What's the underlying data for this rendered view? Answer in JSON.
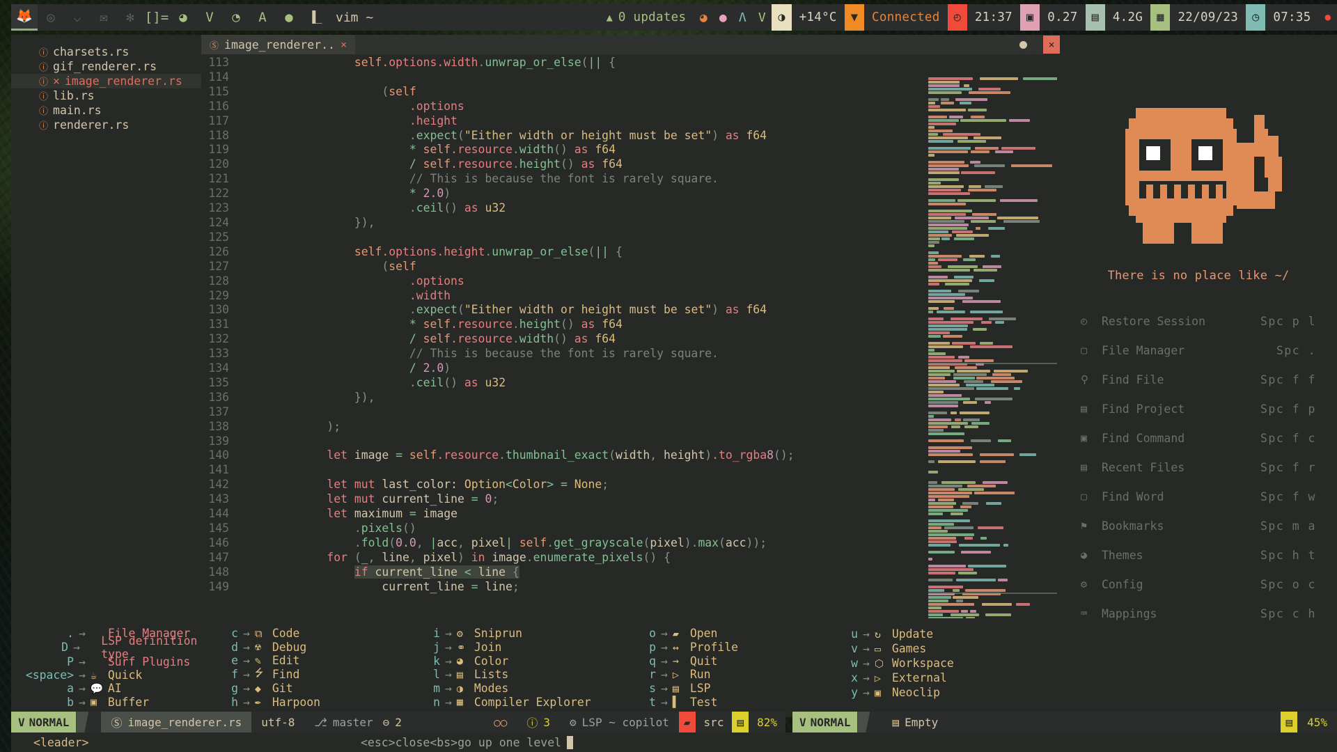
{
  "topbar": {
    "launchers": [
      {
        "name": "firefox-icon",
        "glyph": "🦊",
        "color": "#7fbbb3",
        "active": true
      },
      {
        "name": "chrome-icon",
        "glyph": "◎",
        "color": "#5b605a"
      },
      {
        "name": "download-icon",
        "glyph": "⌵",
        "color": "#5b605a"
      },
      {
        "name": "mail-icon",
        "glyph": "✉",
        "color": "#5b605a"
      },
      {
        "name": "settings-gear-icon",
        "glyph": "✻",
        "color": "#5b605a"
      },
      {
        "name": "terminal-prompt-icon",
        "glyph": "[]=",
        "color": "#a7c080"
      },
      {
        "name": "thunderbird-icon",
        "glyph": "◕",
        "color": "#a7c080"
      },
      {
        "name": "vim-icon",
        "glyph": "V",
        "color": "#a7c080"
      },
      {
        "name": "firefox-dev-icon",
        "glyph": "◔",
        "color": "#a7c080"
      },
      {
        "name": "arch-icon",
        "glyph": "A",
        "color": "#a7c080"
      },
      {
        "name": "dot-icon",
        "glyph": "●",
        "color": "#a7c080"
      }
    ],
    "workspace_icon": "▐_",
    "workspace_label": "vim ~",
    "updates": {
      "icon": "▲",
      "label": "0 updates"
    },
    "tray": [
      {
        "name": "firefox-tray-icon",
        "glyph": "◕",
        "color": "#e8833a"
      },
      {
        "name": "thunderbird-tray-icon",
        "glyph": "●",
        "color": "#e8a0c0"
      },
      {
        "name": "archupdate-tray-icon",
        "glyph": "Λ",
        "color": "#7fbbb3"
      },
      {
        "name": "neovim-tray-icon",
        "glyph": "V",
        "color": "#a7c080"
      }
    ],
    "brightness": {
      "icon": "◑",
      "bg": "#e8e0c0"
    },
    "temperature": "+14°C",
    "wifi": {
      "icon": "▼",
      "bg": "#f08a24",
      "label": "Connected"
    },
    "clock": {
      "icon": "◴",
      "bg": "#f04a3a",
      "label": "21:37"
    },
    "cpu": {
      "icon": "▣",
      "bg": "#e0a0b4",
      "label": "0.27"
    },
    "ram": {
      "icon": "▤",
      "bg": "#a7c0b0",
      "label": "4.2G"
    },
    "date": {
      "icon": "▦",
      "bg": "#a7c080",
      "label": "22/09/23"
    },
    "uptime": {
      "icon": "◷",
      "bg": "#7fbbb3",
      "label": "07:35"
    },
    "power": {
      "icon": "●",
      "color": "#f04a3a"
    }
  },
  "filetree": {
    "items": [
      {
        "icon": "rust-icon",
        "name": "charsets.rs",
        "modified": false,
        "selected": false
      },
      {
        "icon": "rust-icon",
        "name": "gif_renderer.rs",
        "modified": false,
        "selected": false
      },
      {
        "icon": "rust-icon",
        "name": "image_renderer.rs",
        "modified": true,
        "modified_mark": "×",
        "selected": true
      },
      {
        "icon": "rust-icon",
        "name": "lib.rs",
        "modified": false,
        "selected": false
      },
      {
        "icon": "rust-icon",
        "name": "main.rs",
        "modified": false,
        "selected": false
      },
      {
        "icon": "rust-icon",
        "name": "renderer.rs",
        "modified": false,
        "selected": false
      }
    ]
  },
  "editor": {
    "tab": {
      "icon": "rust-icon",
      "label": "image_renderer..",
      "close": "×"
    },
    "window_buttons": {
      "minimize": "",
      "close": "×"
    },
    "first_line": 113,
    "lines": [
      {
        "n": 113,
        "t": "                self.options.width.unwrap_or_else(|| {"
      },
      {
        "n": 114,
        "t": ""
      },
      {
        "n": 115,
        "t": "                    (self"
      },
      {
        "n": 116,
        "t": "                        .options"
      },
      {
        "n": 117,
        "t": "                        .height"
      },
      {
        "n": 118,
        "t": "                        .expect(\"Either width or height must be set\") as f64"
      },
      {
        "n": 119,
        "t": "                        * self.resource.width() as f64"
      },
      {
        "n": 120,
        "t": "                        / self.resource.height() as f64"
      },
      {
        "n": 121,
        "t": "                        // This is because the font is rarely square."
      },
      {
        "n": 122,
        "t": "                        * 2.0)"
      },
      {
        "n": 123,
        "t": "                        .ceil() as u32"
      },
      {
        "n": 124,
        "t": "                }),"
      },
      {
        "n": 125,
        "t": ""
      },
      {
        "n": 126,
        "t": "                self.options.height.unwrap_or_else(|| {"
      },
      {
        "n": 127,
        "t": "                    (self"
      },
      {
        "n": 128,
        "t": "                        .options"
      },
      {
        "n": 129,
        "t": "                        .width"
      },
      {
        "n": 130,
        "t": "                        .expect(\"Either width or height must be set\") as f64"
      },
      {
        "n": 131,
        "t": "                        * self.resource.height() as f64"
      },
      {
        "n": 132,
        "t": "                        / self.resource.width() as f64"
      },
      {
        "n": 133,
        "t": "                        // This is because the font is rarely square."
      },
      {
        "n": 134,
        "t": "                        / 2.0)"
      },
      {
        "n": 135,
        "t": "                        .ceil() as u32"
      },
      {
        "n": 136,
        "t": "                }),"
      },
      {
        "n": 137,
        "t": ""
      },
      {
        "n": 138,
        "t": "            );"
      },
      {
        "n": 139,
        "t": ""
      },
      {
        "n": 140,
        "t": "            let image = self.resource.thumbnail_exact(width, height).to_rgba8();"
      },
      {
        "n": 141,
        "t": ""
      },
      {
        "n": 142,
        "t": "            let mut last_color: Option<Color> = None;"
      },
      {
        "n": 143,
        "t": "            let mut current_line = 0;"
      },
      {
        "n": 144,
        "t": "            let maximum = image"
      },
      {
        "n": 145,
        "t": "                .pixels()"
      },
      {
        "n": 146,
        "t": "                .fold(0.0, |acc, pixel| self.get_grayscale(pixel).max(acc));"
      },
      {
        "n": 147,
        "t": "            for (_, line, pixel) in image.enumerate_pixels() {"
      },
      {
        "n": 148,
        "t": "                if current_line < line {"
      },
      {
        "n": 149,
        "t": "                    current_line = line;"
      }
    ]
  },
  "whichkey": {
    "columns": [
      {
        "rows": [
          {
            "key": ".",
            "label": "File Manager",
            "icon": "",
            "style": "red"
          },
          {
            "key": "D",
            "label": "LSP definition type",
            "icon": "",
            "style": "red"
          },
          {
            "key": "P",
            "label": "Surf Plugins",
            "icon": "",
            "style": "red"
          },
          {
            "key": "<space>",
            "label": "Quick",
            "icon": "☕",
            "style": "yellow"
          },
          {
            "key": "a",
            "label": "AI",
            "icon": "💬",
            "style": "yellow"
          },
          {
            "key": "b",
            "label": "Buffer",
            "icon": "▣",
            "style": "yellow"
          }
        ]
      },
      {
        "rows": [
          {
            "key": "c",
            "label": "Code",
            "icon": "⧉",
            "style": "yellow"
          },
          {
            "key": "d",
            "label": "Debug",
            "icon": "☢",
            "style": "yellow"
          },
          {
            "key": "e",
            "label": "Edit",
            "icon": "✎",
            "style": "yellow"
          },
          {
            "key": "f",
            "label": "Find",
            "icon": "⭍",
            "style": "yellow"
          },
          {
            "key": "g",
            "label": "Git",
            "icon": "◆",
            "style": "yellow"
          },
          {
            "key": "h",
            "label": "Harpoon",
            "icon": "✒",
            "style": "yellow"
          }
        ]
      },
      {
        "rows": [
          {
            "key": "i",
            "label": "Sniprun",
            "icon": "⚙",
            "style": "yellow"
          },
          {
            "key": "j",
            "label": "Join",
            "icon": "⚭",
            "style": "yellow"
          },
          {
            "key": "k",
            "label": "Color",
            "icon": "◕",
            "style": "yellow"
          },
          {
            "key": "l",
            "label": "Lists",
            "icon": "▤",
            "style": "yellow"
          },
          {
            "key": "m",
            "label": "Modes",
            "icon": "◑",
            "style": "yellow"
          },
          {
            "key": "n",
            "label": "Compiler Explorer",
            "icon": "▦",
            "style": "yellow"
          }
        ]
      },
      {
        "rows": [
          {
            "key": "o",
            "label": "Open",
            "icon": "▰",
            "style": "yellow"
          },
          {
            "key": "p",
            "label": "Profile",
            "icon": "↔",
            "style": "yellow"
          },
          {
            "key": "q",
            "label": "Quit",
            "icon": "→",
            "style": "yellow"
          },
          {
            "key": "r",
            "label": "Run",
            "icon": "▷",
            "style": "yellow"
          },
          {
            "key": "s",
            "label": "LSP",
            "icon": "▤",
            "style": "yellow"
          },
          {
            "key": "t",
            "label": "Test",
            "icon": "▌",
            "style": "yellow"
          }
        ]
      },
      {
        "rows": [
          {
            "key": "u",
            "label": "Update",
            "icon": "↻",
            "style": "yellow"
          },
          {
            "key": "v",
            "label": "Games",
            "icon": "▭",
            "style": "yellow"
          },
          {
            "key": "w",
            "label": "Workspace",
            "icon": "⬡",
            "style": "yellow"
          },
          {
            "key": "x",
            "label": "External",
            "icon": "▷",
            "style": "yellow"
          },
          {
            "key": "y",
            "label": "Neoclip",
            "icon": "▣",
            "style": "yellow"
          }
        ]
      }
    ]
  },
  "dashboard": {
    "quote": "There is no place like ~/",
    "items": [
      {
        "icon": "restore-icon",
        "glyph": "◴",
        "label": "Restore Session",
        "key": "Spc p l"
      },
      {
        "icon": "folder-icon",
        "glyph": "▢",
        "label": "File Manager",
        "key": "Spc ."
      },
      {
        "icon": "search-icon",
        "glyph": "⚲",
        "label": "Find File",
        "key": "Spc f f"
      },
      {
        "icon": "project-icon",
        "glyph": "▤",
        "label": "Find Project",
        "key": "Spc f p"
      },
      {
        "icon": "command-icon",
        "glyph": "▣",
        "label": "Find Command",
        "key": "Spc f c"
      },
      {
        "icon": "recent-files-icon",
        "glyph": "▤",
        "label": "Recent Files",
        "key": "Spc f r"
      },
      {
        "icon": "word-icon",
        "glyph": "▢",
        "label": "Find Word",
        "key": "Spc f w"
      },
      {
        "icon": "bookmark-icon",
        "glyph": "⚑",
        "label": "Bookmarks",
        "key": "Spc m a"
      },
      {
        "icon": "palette-icon",
        "glyph": "◕",
        "label": "Themes",
        "key": "Spc h t"
      },
      {
        "icon": "gear-icon",
        "glyph": "⚙",
        "label": "Config",
        "key": "Spc o c"
      },
      {
        "icon": "keyboard-icon",
        "glyph": "⌨",
        "label": "Mappings",
        "key": "Spc c h"
      }
    ]
  },
  "statusbar": {
    "left": {
      "mode_icon": "V",
      "mode": "NORMAL",
      "file_icon": "rust-icon",
      "file": "image_renderer.rs",
      "encoding": "utf-8",
      "branch_icon": "⎇",
      "branch": "master",
      "diff_icon": "⊖",
      "diff_count": "2"
    },
    "center": {
      "copilot_icon": "○○",
      "info_icon": "ⓘ",
      "info_count": "3",
      "lsp_icon": "⚙",
      "lsp": "LSP ~ copilot",
      "folder_icon": "▰",
      "folder": "src",
      "progress_icon": "▤",
      "progress": "82%"
    },
    "right": {
      "mode_icon": "V",
      "mode": "NORMAL",
      "buffer_icon": "▤",
      "buffer": "Empty",
      "progress_icon": "▤",
      "progress": "45%"
    }
  },
  "cmdline": {
    "leader": "<leader>",
    "hint_esc": "<esc>",
    "hint_close": " close ",
    "hint_bs": "<bs>",
    "hint_up": " go up one level"
  },
  "colors": {
    "bg": "#272927",
    "green": "#a7c080",
    "orange": "#e69875",
    "red": "#e67e80",
    "yellow": "#dbbc7f",
    "aqua": "#83c092",
    "blue": "#7fbbb3",
    "purple": "#d699b6",
    "grey": "#859289"
  }
}
